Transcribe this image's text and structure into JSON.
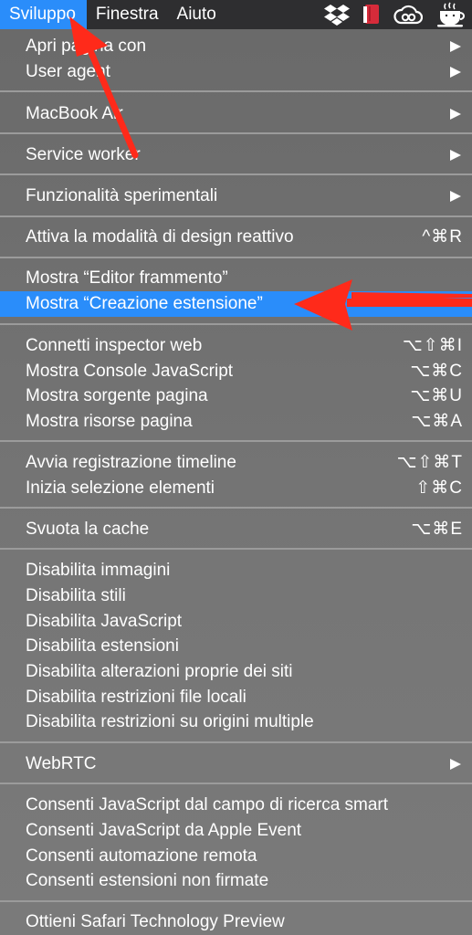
{
  "menubar": {
    "items": [
      {
        "label": "Sviluppo",
        "active": true
      },
      {
        "label": "Finestra",
        "active": false
      },
      {
        "label": "Aiuto",
        "active": false
      }
    ],
    "status_icons": [
      "dropbox-icon",
      "red-book-icon",
      "creative-cloud-icon",
      "coffee-cup-icon"
    ]
  },
  "menu": {
    "items": [
      {
        "label": "Apri pagina con",
        "submenu": true
      },
      {
        "label": "User agent",
        "submenu": true
      },
      {
        "label": "MacBook Air",
        "submenu": true
      },
      {
        "label": "Service worker",
        "submenu": true
      },
      {
        "label": "Funzionalità sperimentali",
        "submenu": true
      },
      {
        "label": "Attiva la modalità di design reattivo",
        "shortcut": "^⌘R"
      },
      {
        "label": "Mostra “Editor frammento”"
      },
      {
        "label": "Mostra “Creazione estensione”",
        "highlighted": true
      },
      {
        "label": "Connetti inspector web",
        "shortcut": "⌥⇧⌘I"
      },
      {
        "label": "Mostra Console JavaScript",
        "shortcut": "⌥⌘C"
      },
      {
        "label": "Mostra sorgente pagina",
        "shortcut": "⌥⌘U"
      },
      {
        "label": "Mostra risorse pagina",
        "shortcut": "⌥⌘A"
      },
      {
        "label": "Avvia registrazione timeline",
        "shortcut": "⌥⇧⌘T"
      },
      {
        "label": "Inizia selezione elementi",
        "shortcut": "⇧⌘C"
      },
      {
        "label": "Svuota la cache",
        "shortcut": "⌥⌘E"
      },
      {
        "label": "Disabilita immagini"
      },
      {
        "label": "Disabilita stili"
      },
      {
        "label": "Disabilita JavaScript"
      },
      {
        "label": "Disabilita estensioni"
      },
      {
        "label": "Disabilita alterazioni proprie dei siti"
      },
      {
        "label": "Disabilita restrizioni file locali"
      },
      {
        "label": "Disabilita restrizioni su origini multiple"
      },
      {
        "label": "WebRTC",
        "submenu": true
      },
      {
        "label": "Consenti JavaScript dal campo di ricerca smart"
      },
      {
        "label": "Consenti JavaScript da Apple Event"
      },
      {
        "label": "Consenti automazione remota"
      },
      {
        "label": "Consenti estensioni non firmate"
      },
      {
        "label": "Ottieni Safari Technology Preview"
      }
    ]
  },
  "colors": {
    "highlight": "#2a8dfa",
    "menubar": "#2e2e30",
    "annotation_arrow": "#ff2a1a"
  }
}
